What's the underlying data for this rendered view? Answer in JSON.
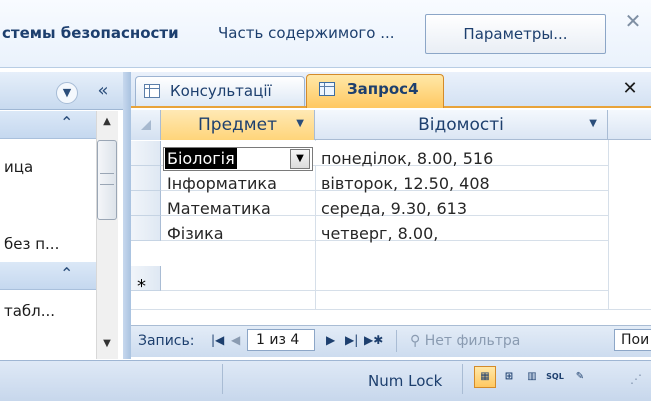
{
  "message_bar": {
    "security_text": "стемы безопасности",
    "part_text": "Часть содержимого ...",
    "params_button": "Параметры...",
    "close_icon": "close-icon"
  },
  "nav_pane": {
    "items": [
      "ица",
      "без п...",
      "табл..."
    ]
  },
  "tabs": [
    {
      "label": "Консультації",
      "icon": "table-icon",
      "active": false
    },
    {
      "label": "Запрос4",
      "icon": "query-icon",
      "active": true
    }
  ],
  "grid": {
    "columns": [
      "Предмет",
      "Відомості"
    ],
    "rows": [
      {
        "subject": "Біологія",
        "info": "понеділок, 8.00, 516"
      },
      {
        "subject": "Інформатика",
        "info": "вівторок, 12.50, 408"
      },
      {
        "subject": "Математика",
        "info": "середа, 9.30, 613"
      },
      {
        "subject": "Фізика",
        "info": "четверг, 8.00,"
      }
    ],
    "new_row_marker": "*"
  },
  "record_nav": {
    "label": "Запись:",
    "position": "1 из 4",
    "filter": "Нет фильтра",
    "search": "Пои"
  },
  "status": {
    "num_lock": "Num Lock",
    "view_sql": "SQL"
  }
}
